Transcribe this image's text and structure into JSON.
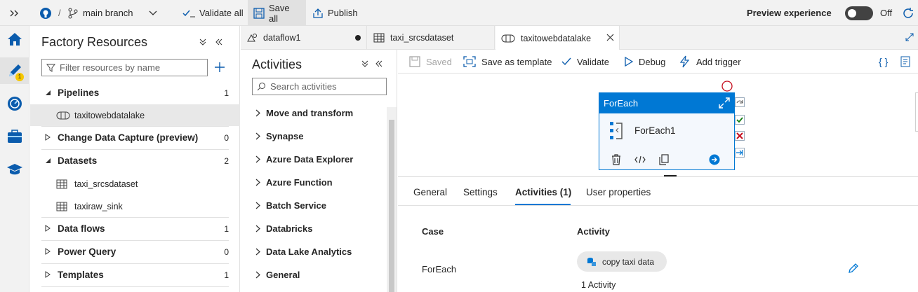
{
  "topbar": {
    "branch": "main branch",
    "validate_all": "Validate all",
    "save_all": "Save all",
    "publish": "Publish",
    "preview_label": "Preview experience",
    "preview_state": "Off"
  },
  "rail": {
    "author_badge": "1"
  },
  "resources": {
    "title": "Factory Resources",
    "filter_placeholder": "Filter resources by name",
    "items": [
      {
        "label": "Pipelines",
        "count": "1"
      },
      {
        "label": "taxitowebdatalake"
      },
      {
        "label": "Change Data Capture (preview)",
        "count": "0"
      },
      {
        "label": "Datasets",
        "count": "2"
      },
      {
        "label": "taxi_srcsdataset"
      },
      {
        "label": "taxiraw_sink"
      },
      {
        "label": "Data flows",
        "count": "1"
      },
      {
        "label": "Power Query",
        "count": "0"
      },
      {
        "label": "Templates",
        "count": "1"
      }
    ]
  },
  "activities": {
    "title": "Activities",
    "search_placeholder": "Search activities",
    "items": [
      "Move and transform",
      "Synapse",
      "Azure Data Explorer",
      "Azure Function",
      "Batch Service",
      "Databricks",
      "Data Lake Analytics",
      "General"
    ]
  },
  "tabs": [
    {
      "label": "dataflow1"
    },
    {
      "label": "taxi_srcsdataset"
    },
    {
      "label": "taxitowebdatalake"
    }
  ],
  "toolbar": {
    "saved": "Saved",
    "save_as_template": "Save as template",
    "validate": "Validate",
    "debug": "Debug",
    "add_trigger": "Add trigger"
  },
  "node": {
    "type": "ForEach",
    "name": "ForEach1"
  },
  "bottom": {
    "tabs": [
      "General",
      "Settings",
      "Activities (1)",
      "User properties"
    ],
    "columns": {
      "case": "Case",
      "activity": "Activity"
    },
    "row": {
      "case": "ForEach",
      "activity_name": "copy taxi data",
      "activity_count": "1 Activity"
    }
  },
  "colors": {
    "accent": "#0078d4",
    "badge": "#f6c700",
    "success": "#107c10",
    "failure": "#c50f1f"
  }
}
